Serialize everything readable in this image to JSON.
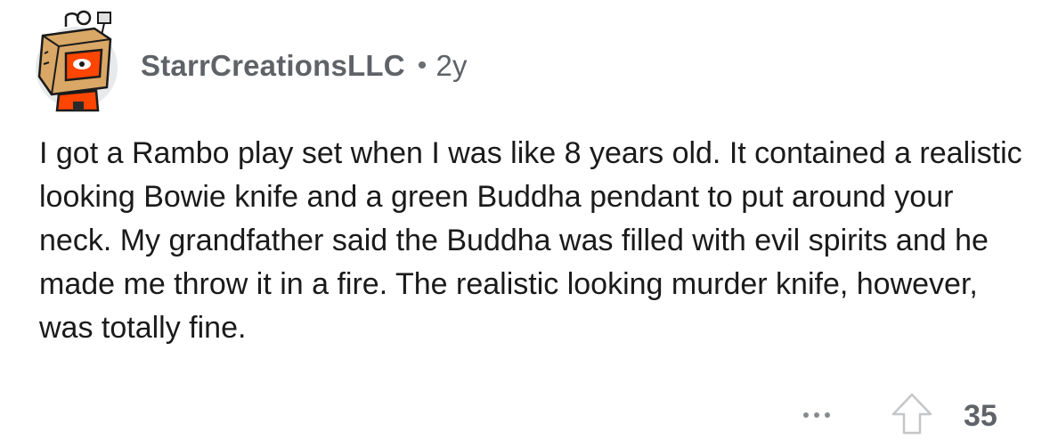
{
  "comment": {
    "author": "StarrCreationsLLC",
    "separator": "•",
    "age": "2y",
    "body": "I got a Rambo play set when I was like 8 years old. It contained a realistic looking Bowie knife and a green Buddha pendant to put around your neck. My grandfather said the Buddha was filled with evil spirits and he made me throw it in a fire. The realistic looking murder knife, however, was totally fine.",
    "score": "35"
  },
  "icons": {
    "avatar": "snoo-box-robot-avatar",
    "more": "more-horizontal-icon",
    "upvote": "upvote-arrow-icon"
  },
  "colors": {
    "text": "#1a1a1b",
    "meta": "#5f6368",
    "icon": "#878a8c",
    "avatar_accent": "#ff4500"
  }
}
